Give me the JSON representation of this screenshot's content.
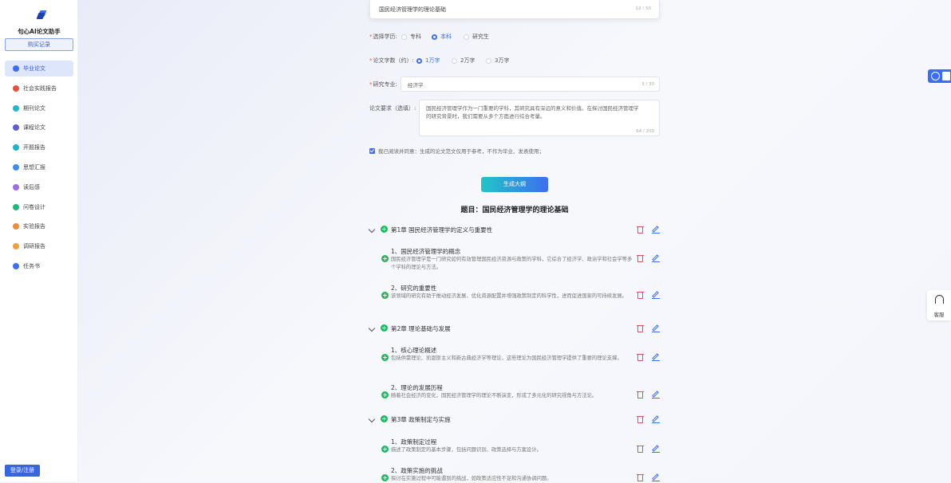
{
  "app": {
    "title": "句心AI论文助手",
    "buy_records": "购买记录",
    "login": "登录/注册"
  },
  "sidebar": {
    "items": [
      {
        "label": "毕业论文",
        "color": "#3b6df6"
      },
      {
        "label": "社会实践报告",
        "color": "#e5533f"
      },
      {
        "label": "期刊论文",
        "color": "#22b8c9"
      },
      {
        "label": "课程论文",
        "color": "#5a5fd6"
      },
      {
        "label": "开题报告",
        "color": "#1cb5c9"
      },
      {
        "label": "思想汇报",
        "color": "#3b8ef0"
      },
      {
        "label": "读后感",
        "color": "#9b6ee8"
      },
      {
        "label": "问卷设计",
        "color": "#22b87a"
      },
      {
        "label": "实验报告",
        "color": "#f08c3a"
      },
      {
        "label": "调研报告",
        "color": "#f0a03a"
      },
      {
        "label": "任务书",
        "color": "#3b6df6"
      }
    ]
  },
  "form": {
    "title_value": "国民经济管理学的理论基础",
    "title_count": "12 / 50",
    "degree_label": "选择学历:",
    "degree_options": [
      "专科",
      "本科",
      "研究生"
    ],
    "words_label": "论文字数（约）:",
    "words_options": [
      "1万字",
      "2万字",
      "3万字"
    ],
    "major_label": "研究专业:",
    "major_value": "经济学",
    "major_count": "3 / 30",
    "req_label": "论文要求（选填）:",
    "req_value": "国民经济管理学作为一门重要的学科，其研究具有深远的意义和价值。在探讨国民经济管理学的研究背景时，我们需要从多个方面进行综合考量。",
    "req_count": "64 / 200",
    "agree_text": "我已阅读并同意：生成的论文范文仅用于参考，不作为毕业、发表使用；",
    "generate_btn": "生成大纲"
  },
  "outline": {
    "title": "题目：国民经济管理学的理论基础",
    "chapters": [
      {
        "title": "第1章 国民经济管理学的定义与重要性",
        "sections": [
          {
            "title": "1、国民经济管理学的概念",
            "desc": "国民经济管理学是一门研究如何有效管理国民经济资源与政策的学科，它综合了经济学、政治学和社会学等多个学科的理论与方法。"
          },
          {
            "title": "2、研究的重要性",
            "desc": "该领域的研究有助于推动经济发展、优化资源配置并增强政策制定的科学性，进而促进国家的可持续发展。"
          }
        ]
      },
      {
        "title": "第2章 理论基础与发展",
        "sections": [
          {
            "title": "1、核心理论概述",
            "desc": "包括供需理论、凯恩斯主义和新古典经济学等理论，这些理论为国民经济管理学提供了重要的理论支撑。"
          },
          {
            "title": "2、理论的发展历程",
            "desc": "随着社会经济的变化，国民经济管理学的理论不断演变，形成了多元化的研究视角与方法论。"
          }
        ]
      },
      {
        "title": "第3章 政策制定与实施",
        "sections": [
          {
            "title": "1、政策制定过程",
            "desc": "描述了政策制定的基本步骤，包括问题识别、政策选择与方案设计。"
          },
          {
            "title": "2、政策实施的挑战",
            "desc": "探讨在实施过程中可能遇到的挑战，如政策适应性不足和沟通协调问题。"
          }
        ]
      }
    ]
  },
  "float": {
    "service": "客服"
  }
}
